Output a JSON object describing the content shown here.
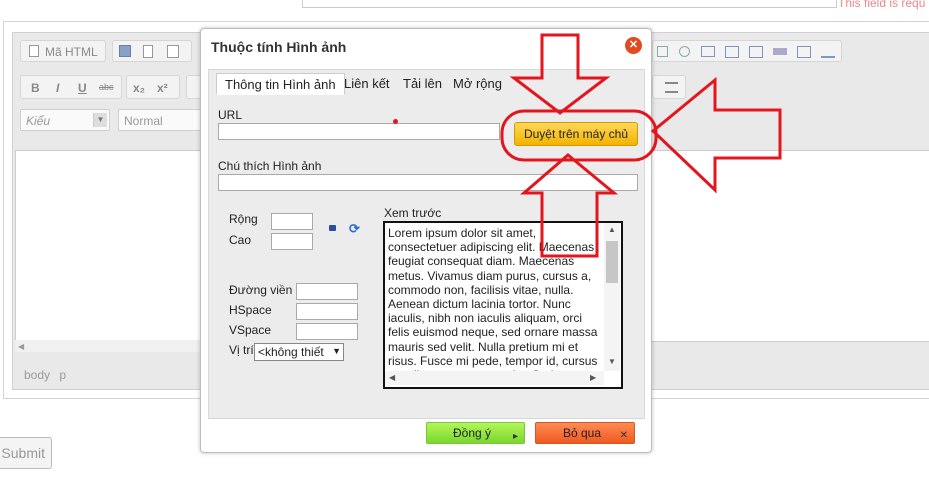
{
  "background": {
    "required_message": "This field is requ",
    "toolbar": {
      "source_label": "Mã HTML",
      "format_combo": "Kiểu",
      "style_combo": "Normal",
      "bold": "B",
      "italic": "I",
      "underline": "U",
      "strike": "abc",
      "subscript": "x₂",
      "superscript": "x²"
    },
    "status_path": "body p",
    "submit_label": "Submit"
  },
  "dialog": {
    "title": "Thuộc tính Hình ảnh",
    "close_glyph": "✕",
    "tabs": [
      {
        "label": "Thông tin Hình ảnh",
        "active": true
      },
      {
        "label": "Liên kết",
        "active": false
      },
      {
        "label": "Tải lên",
        "active": false
      },
      {
        "label": "Mở rộng",
        "active": false
      }
    ],
    "url_label": "URL",
    "url_value": "",
    "browse_button": "Duyệt trên máy chủ",
    "alt_label": "Chú thích Hình ảnh",
    "alt_value": "",
    "width_label": "Rộng",
    "height_label": "Cao",
    "border_label": "Đường viền",
    "hspace_label": "HSpace",
    "vspace_label": "VSpace",
    "align_label": "Vị trí",
    "align_selected": "<không thiết",
    "preview_label": "Xem trước",
    "preview_text": "Lorem ipsum dolor sit amet, consectetuer adipiscing elit. Maecenas feugiat consequat diam. Maecenas metus. Vivamus diam purus, cursus a, commodo non, facilisis vitae, nulla. Aenean dictum lacinia tortor. Nunc iaculis, nibh non iaculis aliquam, orci felis euismod neque, sed ornare massa mauris sed velit. Nulla pretium mi et risus. Fusce mi pede, tempor id, cursus ac, ullamcorper nec, enim. Sed tortor.",
    "ok_button": "Đồng ý",
    "cancel_button": "Bỏ qua"
  },
  "colors": {
    "browse_button": "#f5bb0f",
    "ok_button": "#8ee03a",
    "cancel_button": "#f26a2e",
    "annotation_red": "#e3161e"
  }
}
